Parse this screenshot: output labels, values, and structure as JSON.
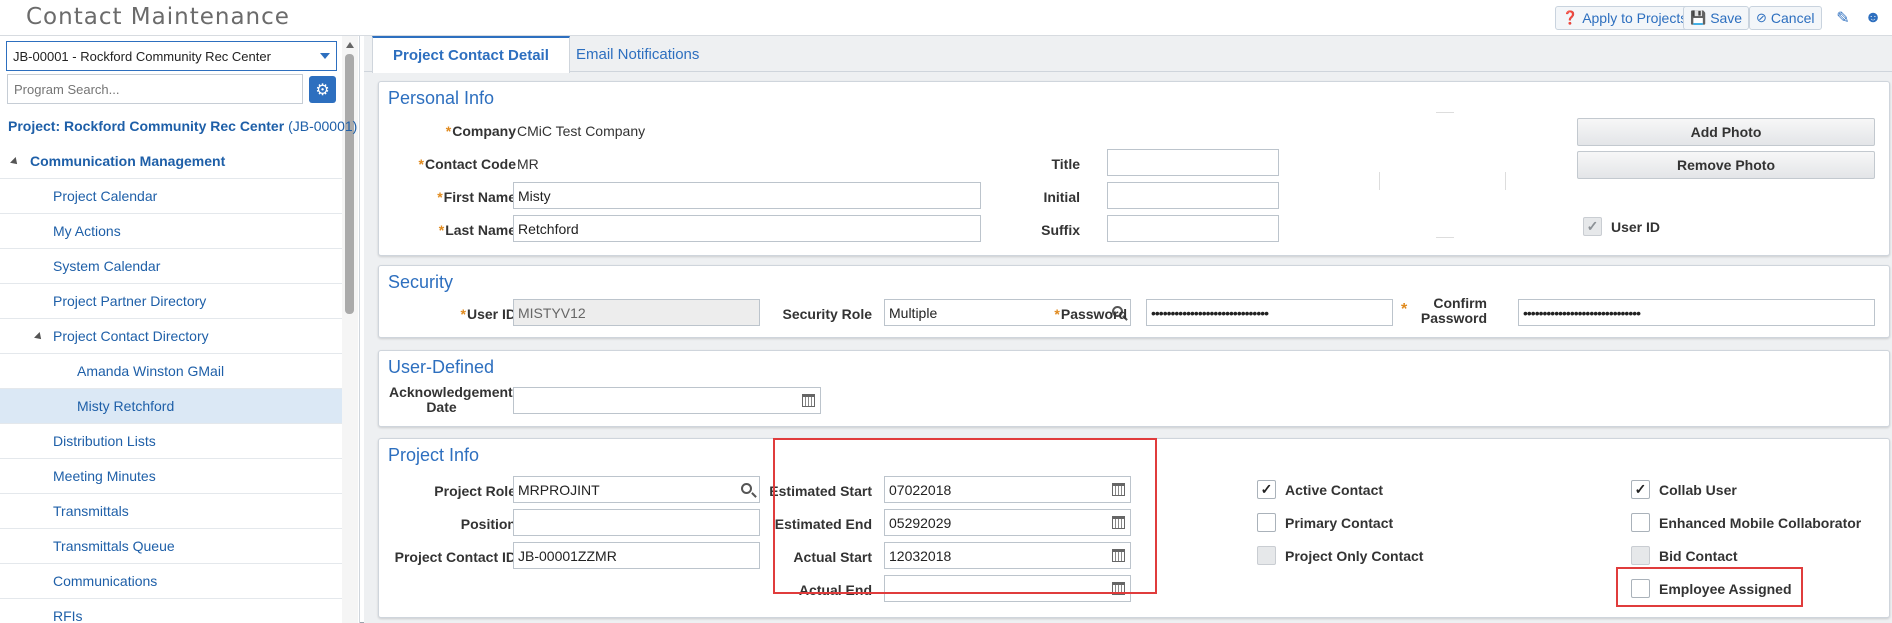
{
  "header": {
    "title": "Contact Maintenance",
    "apply_label": "Apply to Projects",
    "save_label": "Save",
    "cancel_label": "Cancel"
  },
  "sidebar": {
    "project_select": "JB-00001 - Rockford Community Rec Center",
    "search_placeholder": "Program Search...",
    "project_link": "Project: Rockford Community Rec Center",
    "project_code": "(JB-00001)",
    "items": [
      {
        "label": "Communication Management"
      },
      {
        "label": "Project Calendar"
      },
      {
        "label": "My Actions"
      },
      {
        "label": "System Calendar"
      },
      {
        "label": "Project Partner Directory"
      },
      {
        "label": "Project Contact Directory"
      },
      {
        "label": "Amanda Winston GMail"
      },
      {
        "label": "Misty Retchford"
      },
      {
        "label": "Distribution Lists"
      },
      {
        "label": "Meeting Minutes"
      },
      {
        "label": "Transmittals"
      },
      {
        "label": "Transmittals Queue"
      },
      {
        "label": "Communications"
      },
      {
        "label": "RFIs"
      }
    ]
  },
  "tabs": [
    {
      "label": "Project Contact Detail"
    },
    {
      "label": "Email Notifications"
    }
  ],
  "personal": {
    "title": "Personal Info",
    "company_label": "Company",
    "company_value": "CMiC Test Company",
    "contact_code_label": "Contact Code",
    "contact_code_value": "MR",
    "first_name_label": "First Name",
    "first_name_value": "Misty",
    "last_name_label": "Last Name",
    "last_name_value": "Retchford",
    "title_label": "Title",
    "title_value": "",
    "initial_label": "Initial",
    "initial_value": "",
    "suffix_label": "Suffix",
    "suffix_value": "",
    "add_photo": "Add Photo",
    "remove_photo": "Remove Photo",
    "user_id_check_label": "User ID",
    "user_id_checked": true
  },
  "security": {
    "title": "Security",
    "user_id_label": "User ID",
    "user_id_value": "MISTYV12",
    "role_label": "Security Role",
    "role_value": "Multiple",
    "password_label": "Password",
    "password_value": "••••••••••••••••••••••••••••••",
    "confirm_label": "Confirm Password",
    "confirm_value": "••••••••••••••••••••••••••••••"
  },
  "user_defined": {
    "title": "User-Defined",
    "ack_label": "Acknowledgement Date",
    "ack_value": ""
  },
  "project": {
    "title": "Project Info",
    "role_label": "Project Role",
    "role_value": "MRPROJINT",
    "position_label": "Position",
    "position_value": "",
    "contact_id_label": "Project Contact ID",
    "contact_id_value": "JB-00001ZZMR",
    "est_start_label": "Estimated Start",
    "est_start_value": "07022018",
    "est_end_label": "Estimated End",
    "est_end_value": "05292029",
    "act_start_label": "Actual Start",
    "act_start_value": "12032018",
    "act_end_label": "Actual End",
    "act_end_value": "",
    "checks": {
      "active": {
        "label": "Active Contact",
        "checked": true
      },
      "primary": {
        "label": "Primary Contact",
        "checked": false
      },
      "project_only": {
        "label": "Project Only Contact",
        "checked": false
      },
      "collab": {
        "label": "Collab User",
        "checked": true
      },
      "enhanced": {
        "label": "Enhanced Mobile Collaborator",
        "checked": false
      },
      "bid": {
        "label": "Bid Contact",
        "checked": false
      },
      "employee": {
        "label": "Employee Assigned",
        "checked": false
      }
    }
  }
}
